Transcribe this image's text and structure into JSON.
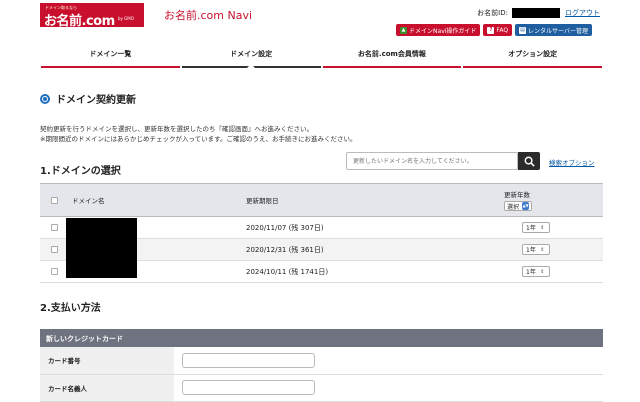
{
  "header": {
    "logo_tagline": "ドメイン取るなら",
    "logo_text": "お名前.com",
    "logo_sub": "by GMO",
    "app_title": "お名前.com Navi",
    "account_label": "お名前ID:",
    "logout": "ログアウト",
    "buttons": {
      "guide": "ドメインNavi操作ガイド",
      "faq": "FAQ",
      "server": "レンタルサーバー管理"
    }
  },
  "nav": {
    "tabs": [
      {
        "label": "ドメイン一覧"
      },
      {
        "label": "ドメイン設定"
      },
      {
        "label": "お名前.com会員情報"
      },
      {
        "label": "オプション設定"
      }
    ]
  },
  "page": {
    "title": "ドメイン契約更新",
    "description_1": "契約更新を行うドメインを選択し、更新年数を選択したのち『確認画面』へお進みください。",
    "description_2": "※期限間近のドメインにはあらかじめチェックが入っています。ご確認のうえ、お手続きにお進みください。"
  },
  "section1": {
    "title": "1.ドメインの選択",
    "search_placeholder": "更新したいドメイン名を入力してください。",
    "search_option": "検索オプション",
    "columns": {
      "name": "ドメイン名",
      "expiry": "更新期限日",
      "years": "更新年数",
      "years_select": "選択"
    },
    "rows": [
      {
        "expiry": "2020/11/07 (残 307日)",
        "years": "1年"
      },
      {
        "expiry": "2020/12/31 (残 361日)",
        "years": "1年"
      },
      {
        "expiry": "2024/10/11 (残 1741日)",
        "years": "1年"
      }
    ]
  },
  "section2": {
    "title": "2.支払い方法",
    "card_header": "新しいクレジットカード",
    "fields": {
      "card_number": "カード番号",
      "card_holder": "カード名義人"
    }
  }
}
